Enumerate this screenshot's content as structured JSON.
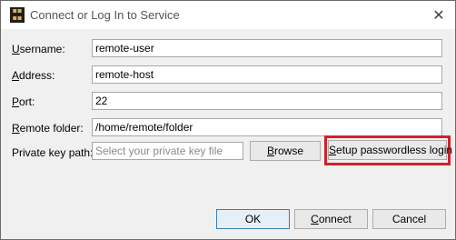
{
  "window": {
    "title": "Connect or Log In to Service",
    "close_glyph": "✕"
  },
  "form": {
    "username": {
      "label_key": "U",
      "label_rest": "sername:",
      "value": "remote-user"
    },
    "address": {
      "label_key": "A",
      "label_rest": "ddress:",
      "value": "remote-host"
    },
    "port": {
      "label_key": "P",
      "label_rest": "ort:",
      "value": "22"
    },
    "remote_folder": {
      "label_key": "R",
      "label_rest": "emote folder:",
      "value": "/home/remote/folder"
    },
    "private_key": {
      "label": "Private key path:",
      "placeholder": "Select your private key file"
    }
  },
  "buttons": {
    "browse": {
      "key": "B",
      "rest": "rowse"
    },
    "setup": {
      "key": "S",
      "rest": "etup passwordless login"
    },
    "ok": "OK",
    "connect": {
      "key": "C",
      "rest": "onnect"
    },
    "cancel": "Cancel"
  },
  "highlight_color": "#d2202b"
}
